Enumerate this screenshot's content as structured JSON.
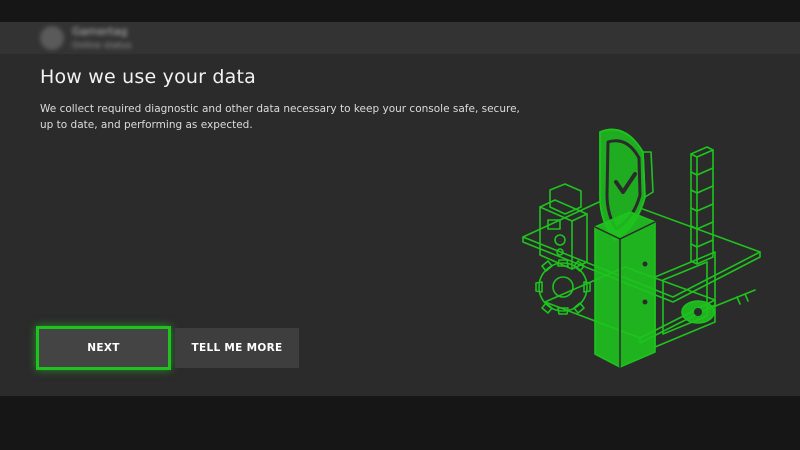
{
  "header": {
    "gamertag": "Gamertag",
    "status": "Online status"
  },
  "page": {
    "title": "How we use your data",
    "description": "We collect required diagnostic and other data necessary to keep your console safe, secure, up to date, and performing as expected."
  },
  "buttons": {
    "next_label": "NEXT",
    "more_label": "TELL ME MORE"
  },
  "colors": {
    "accent_green": "#1ec31e",
    "background": "#2b2b2b",
    "button_bg": "#3e3e3e"
  },
  "illustration": {
    "icons": [
      "shield-check-icon",
      "gear-icon",
      "key-icon",
      "server-tower-icon",
      "cube-stack-icon"
    ]
  }
}
